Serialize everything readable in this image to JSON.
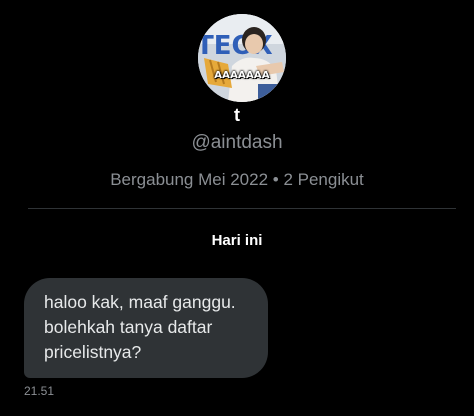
{
  "profile": {
    "avatar_icon": "profile-photo",
    "avatar_caption": "AAAAAAA",
    "avatar_banner_text": "TEOX",
    "display_name": "t",
    "handle": "@aintdash",
    "meta": "Bergabung Mei 2022 • 2 Pengikut"
  },
  "conversation": {
    "date_separator": "Hari ini",
    "messages": [
      {
        "lines": [
          "haloo kak, maaf ganggu.",
          "bolehkah tanya daftar",
          "pricelistnya?"
        ],
        "time": "21.51"
      }
    ]
  },
  "colors": {
    "background": "#000000",
    "bubble": "#2f3336",
    "secondary_text": "#8b8f94",
    "divider": "#2f3336"
  }
}
